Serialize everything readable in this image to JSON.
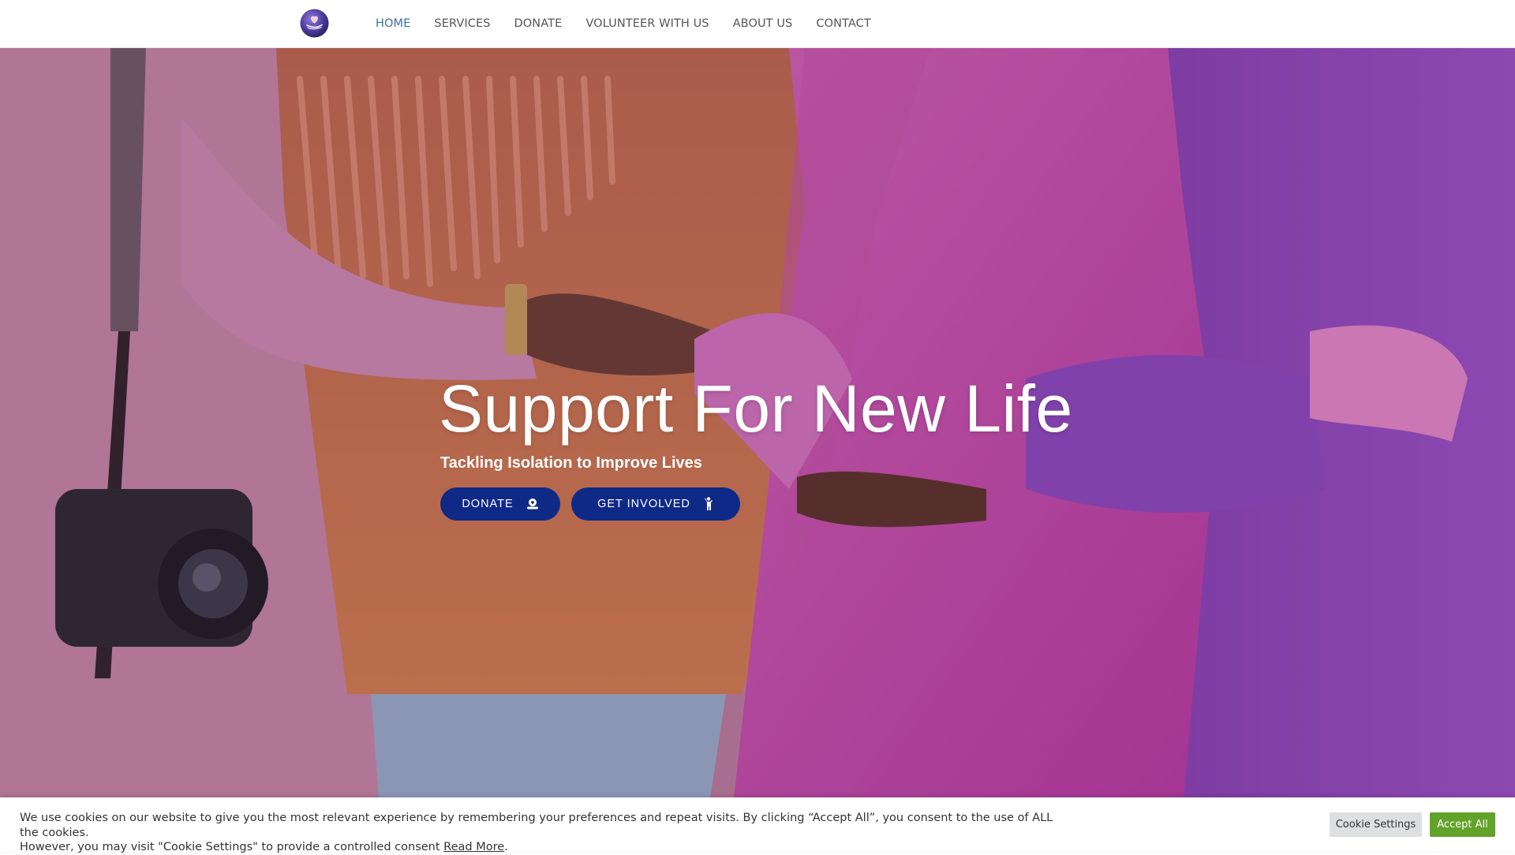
{
  "header": {
    "logo_name": "heart-hand-logo",
    "nav": [
      {
        "label": "HOME",
        "active": true
      },
      {
        "label": "SERVICES",
        "active": false
      },
      {
        "label": "DONATE",
        "active": false
      },
      {
        "label": "VOLUNTEER WITH US",
        "active": false
      },
      {
        "label": "ABOUT US",
        "active": false
      },
      {
        "label": "CONTACT",
        "active": false
      }
    ]
  },
  "hero": {
    "background": "photo of friends in pink, orange and purple coats with arms around each other",
    "title": "Support For New Life",
    "subtitle": "Tackling Isolation to Improve Lives",
    "buttons": {
      "donate_label": "DONATE",
      "donate_icon": "donation-hand-icon",
      "involved_label": "GET INVOLVED",
      "involved_icon": "raised-hand-person-icon"
    }
  },
  "cookie": {
    "line1": "We use cookies on our website to give you the most relevant experience by remembering your preferences and repeat visits. By clicking “Accept All”, you consent to the use of ALL the cookies.",
    "line2": "However, you may visit \"Cookie Settings\" to provide a controlled consent ",
    "read_more": "Read More",
    "period": ".",
    "settings_label": "Cookie Settings",
    "accept_label": "Accept All"
  },
  "colors": {
    "nav_active": "#3b6fa5",
    "nav_text": "#555555",
    "button_bg": "#0f2a86",
    "accept_bg": "#61a229",
    "settings_bg": "#dedfe0"
  }
}
